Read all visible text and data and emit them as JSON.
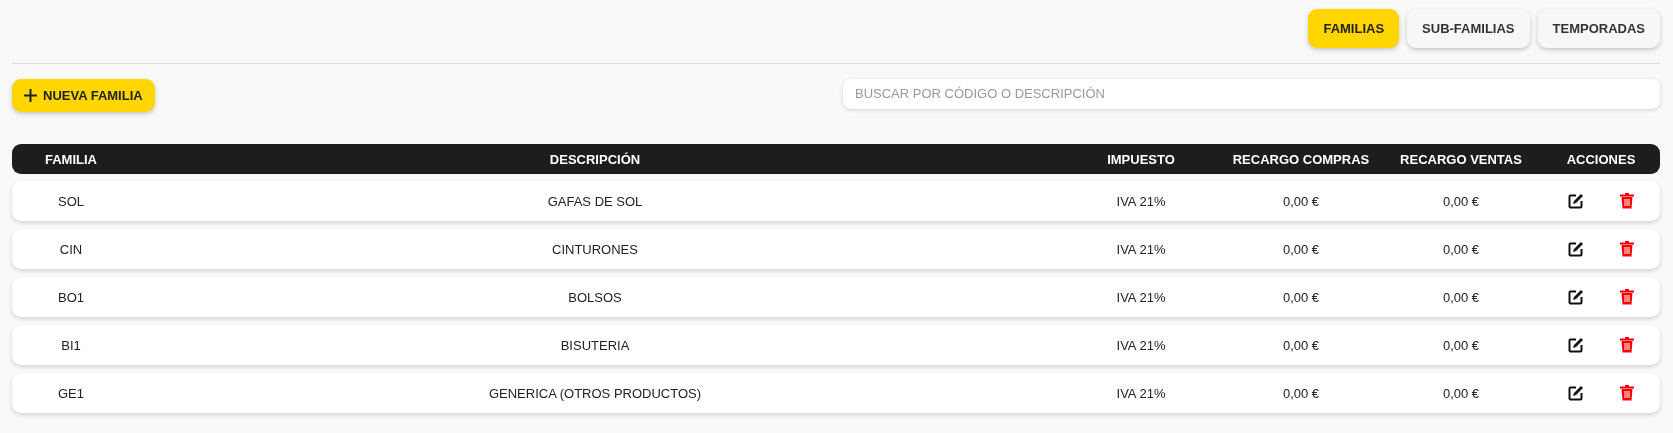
{
  "tabs": [
    {
      "label": "FAMILIAS",
      "selected": true
    },
    {
      "label": "SUB-FAMILIAS",
      "selected": false
    },
    {
      "label": "TEMPORADAS",
      "selected": false
    }
  ],
  "new_button": {
    "label": "NUEVA FAMILIA"
  },
  "search": {
    "placeholder": "BUSCAR POR CÓDIGO O DESCRIPCIÓN"
  },
  "table": {
    "columns": [
      "FAMILIA",
      "DESCRIPCIÓN",
      "IMPUESTO",
      "RECARGO COMPRAS",
      "RECARGO VENTAS",
      "ACCIONES"
    ],
    "rows": [
      {
        "familia": "SOL",
        "descripcion": "GAFAS DE SOL",
        "impuesto": "IVA 21%",
        "recargo_compras": "0,00 €",
        "recargo_ventas": "0,00 €"
      },
      {
        "familia": "CIN",
        "descripcion": "CINTURONES",
        "impuesto": "IVA 21%",
        "recargo_compras": "0,00 €",
        "recargo_ventas": "0,00 €"
      },
      {
        "familia": "BO1",
        "descripcion": "BOLSOS",
        "impuesto": "IVA 21%",
        "recargo_compras": "0,00 €",
        "recargo_ventas": "0,00 €"
      },
      {
        "familia": "BI1",
        "descripcion": "BISUTERIA",
        "impuesto": "IVA 21%",
        "recargo_compras": "0,00 €",
        "recargo_ventas": "0,00 €"
      },
      {
        "familia": "GE1",
        "descripcion": "GENERICA (OTROS PRODUCTOS)",
        "impuesto": "IVA 21%",
        "recargo_compras": "0,00 €",
        "recargo_ventas": "0,00 €"
      }
    ]
  }
}
